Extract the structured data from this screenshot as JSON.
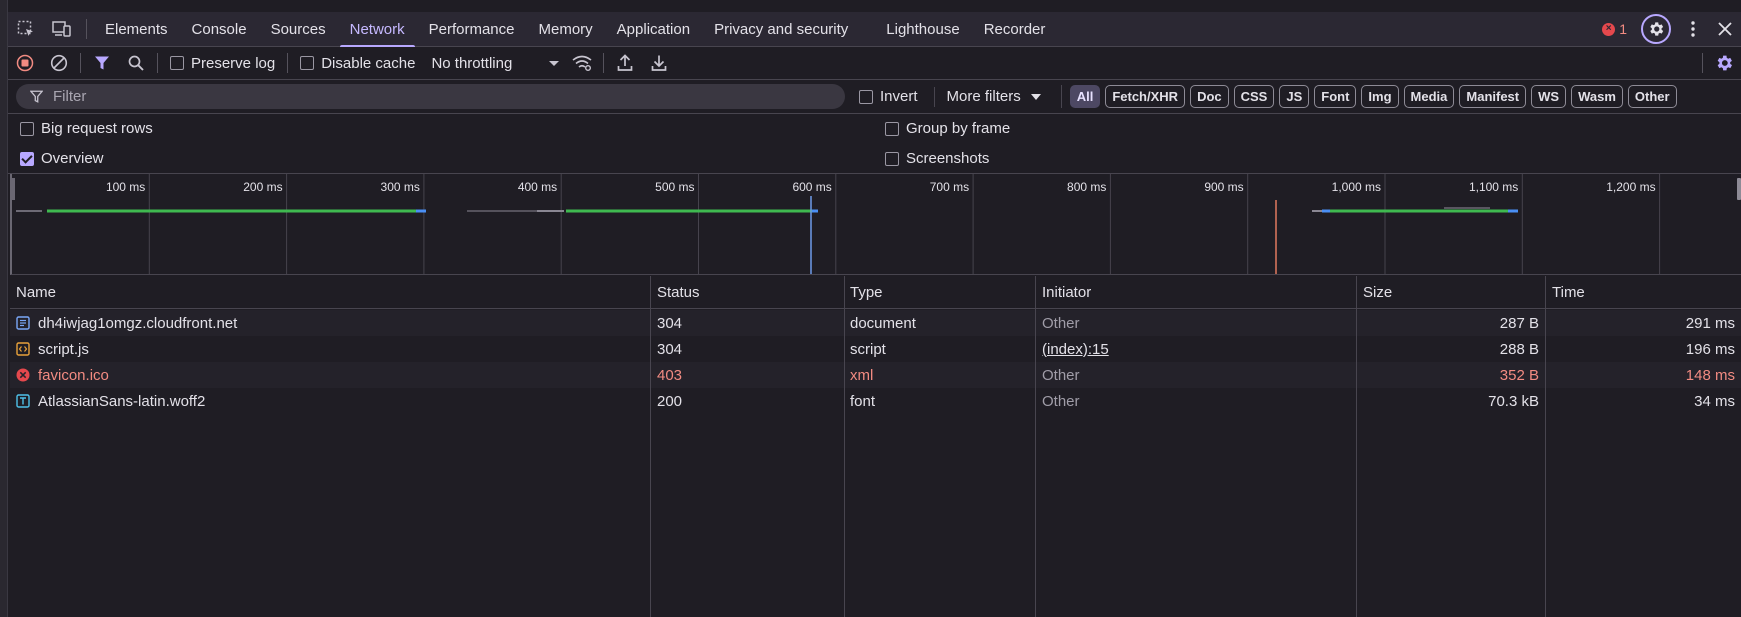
{
  "tabs": {
    "items": [
      "Elements",
      "Console",
      "Sources",
      "Network",
      "Performance",
      "Memory",
      "Application",
      "Privacy and security",
      "Lighthouse",
      "Recorder"
    ],
    "active": "Network"
  },
  "status": {
    "error_count": "1",
    "error_glyph": "×"
  },
  "toolbar": {
    "preserve_log": "Preserve log",
    "disable_cache": "Disable cache",
    "throttling": "No throttling"
  },
  "filter": {
    "placeholder": "Filter",
    "invert": "Invert",
    "more_filters": "More filters",
    "types": [
      "All",
      "Fetch/XHR",
      "Doc",
      "CSS",
      "JS",
      "Font",
      "Img",
      "Media",
      "Manifest",
      "WS",
      "Wasm",
      "Other"
    ],
    "active_type": "All"
  },
  "settings": {
    "big_request_rows": "Big request rows",
    "overview": "Overview",
    "group_by_frame": "Group by frame",
    "screenshots": "Screenshots",
    "overview_checked": true
  },
  "overview": {
    "ticks": [
      "100 ms",
      "200 ms",
      "300 ms",
      "400 ms",
      "500 ms",
      "600 ms",
      "700 ms",
      "800 ms",
      "900 ms",
      "1,000 ms",
      "1,100 ms",
      "1,200 ms"
    ]
  },
  "table": {
    "columns": [
      "Name",
      "Status",
      "Type",
      "Initiator",
      "Size",
      "Time"
    ],
    "rows": [
      {
        "name": "dh4iwjag1omgz.cloudfront.net",
        "status": "304",
        "type": "document",
        "initiator": "Other",
        "size": "287 B",
        "time": "291 ms",
        "icon": "document-icon",
        "error": false,
        "initiator_link": false
      },
      {
        "name": "script.js",
        "status": "304",
        "type": "script",
        "initiator": "(index):15",
        "size": "288 B",
        "time": "196 ms",
        "icon": "script-icon",
        "error": false,
        "initiator_link": true
      },
      {
        "name": "favicon.ico",
        "status": "403",
        "type": "xml",
        "initiator": "Other",
        "size": "352 B",
        "time": "148 ms",
        "icon": "error-icon",
        "error": true,
        "initiator_link": false
      },
      {
        "name": "AtlassianSans-latin.woff2",
        "status": "200",
        "type": "font",
        "initiator": "Other",
        "size": "70.3 kB",
        "time": "34 ms",
        "icon": "font-icon",
        "error": false,
        "initiator_link": false
      }
    ]
  },
  "colors": {
    "accent": "#b8a8ff",
    "error": "#f28b82",
    "waterfall_green": "#3fb950",
    "waterfall_blue": "#4a8ff5"
  }
}
